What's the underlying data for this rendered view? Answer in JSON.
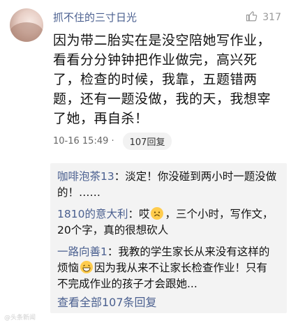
{
  "comment": {
    "username": "抓不住的三寸日光",
    "likes": "317",
    "text": "因为带二胎实在是没空陪她写作业，看看分分钟钟把作业做完，高兴死了，检查的时候，我靠，五题错两题，还有一题没做，我的天，我想宰了她，再自杀！",
    "timestamp": "10-16 15:49 ·",
    "reply_label": "107回复"
  },
  "replies": [
    {
      "name": "咖啡泡茶13",
      "text": "：淡定！你没碰到两小时一题没做的！……"
    },
    {
      "name": "1810的意大利",
      "text_before": "：哎",
      "emoji": "sad-face-emoji",
      "text_after": "，三个小时，写作文，20个字，真的很想砍人"
    },
    {
      "name": "一路向善1",
      "text_before": "：我教的学生家长从来没有这样的烦恼",
      "emoji": "grin-emoji",
      "text_after": "因为我从来不让家长检查作业！只有不完成作业的孩子才会跟她..."
    }
  ],
  "view_all": "查看全部107条回复",
  "watermark": "@头条新闻"
}
